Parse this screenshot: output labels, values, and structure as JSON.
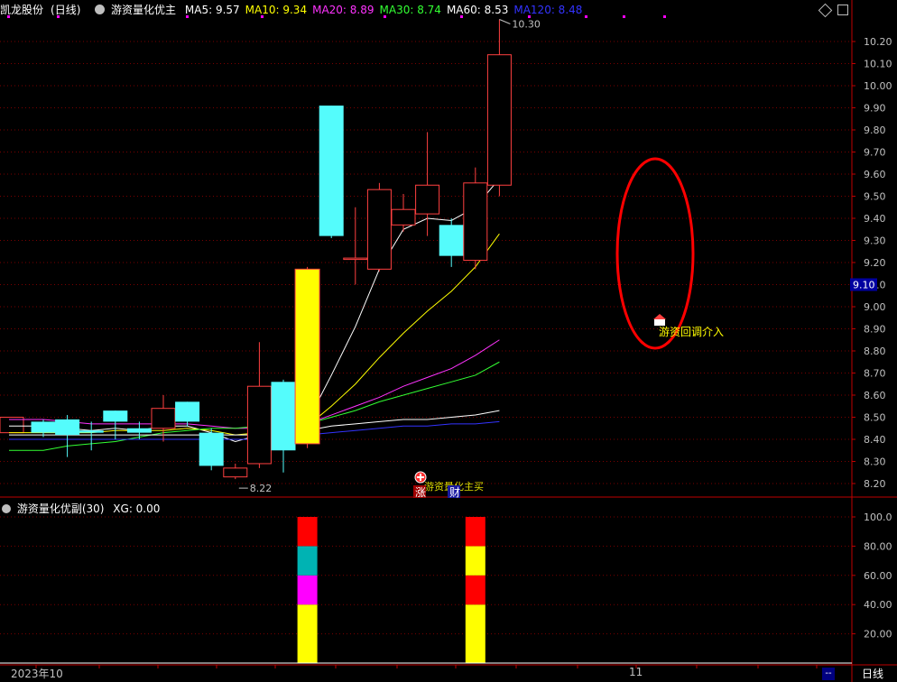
{
  "header": {
    "stock_name": "凯龙股份",
    "period_label": "(日线)",
    "indicator_name": "游资量化优主",
    "ma_items": [
      {
        "label": "MA5:",
        "value": "9.57",
        "color": "#ffffff"
      },
      {
        "label": "MA10:",
        "value": "9.34",
        "color": "#ffff00"
      },
      {
        "label": "MA20:",
        "value": "8.89",
        "color": "#ff33ff"
      },
      {
        "label": "MA30:",
        "value": "8.74",
        "color": "#33ff33"
      },
      {
        "label": "MA60:",
        "value": "8.53",
        "color": "#ffffff"
      },
      {
        "label": "MA120:",
        "value": "8.48",
        "color": "#3333ff"
      }
    ]
  },
  "sub_header": {
    "indicator_name": "游资量化优副(30)",
    "xg_label": "XG: 0.00"
  },
  "annotations": {
    "high_label": "10.30",
    "low_label": "8.22",
    "signal_text": "游资回调介入",
    "buy_text": "游资量化主买",
    "limit_up_tag": "涨",
    "finance_tag": "财",
    "current_price_tag": "9.10"
  },
  "bottom": {
    "date_left": "2023年10",
    "date_month": "11",
    "period_button": "日线",
    "minus_label": "--"
  },
  "colors": {
    "up": "#ff4040",
    "down": "#54fcfc",
    "limit_up": "#ffff00",
    "grid": "#7a0000",
    "axis": "#c00000",
    "circle": "#ff0000"
  },
  "chart_data": [
    {
      "type": "candlestick",
      "ylim": [
        8.15,
        10.35
      ],
      "y_ticks": [
        "10.20",
        "10.10",
        "10.00",
        "9.90",
        "9.80",
        "9.70",
        "9.60",
        "9.50",
        "9.40",
        "9.30",
        "9.20",
        "9.10",
        "9.00",
        "8.90",
        "8.80",
        "8.70",
        "8.60",
        "8.50",
        "8.40",
        "8.30",
        "8.20"
      ],
      "candles": [
        {
          "o": 8.48,
          "c": 8.43,
          "h": 8.49,
          "l": 8.41
        },
        {
          "o": 8.49,
          "c": 8.42,
          "h": 8.51,
          "l": 8.32
        },
        {
          "o": 8.44,
          "c": 8.43,
          "h": 8.48,
          "l": 8.35
        },
        {
          "o": 8.53,
          "c": 8.48,
          "h": 8.53,
          "l": 8.4
        },
        {
          "o": 8.45,
          "c": 8.43,
          "h": 8.48,
          "l": 8.4
        },
        {
          "o": 8.45,
          "c": 8.54,
          "h": 8.6,
          "l": 8.39
        },
        {
          "o": 8.57,
          "c": 8.48,
          "h": 8.57,
          "l": 8.46
        },
        {
          "o": 8.43,
          "c": 8.28,
          "h": 8.45,
          "l": 8.26
        },
        {
          "o": 8.23,
          "c": 8.27,
          "h": 8.29,
          "l": 8.22
        },
        {
          "o": 8.29,
          "c": 8.64,
          "h": 8.84,
          "l": 8.27
        },
        {
          "o": 8.66,
          "c": 8.35,
          "h": 8.67,
          "l": 8.25
        },
        {
          "o": 8.38,
          "c": 9.17,
          "h": 9.18,
          "l": 8.36,
          "limit": true
        },
        {
          "o": 9.91,
          "c": 9.32,
          "h": 9.91,
          "l": 9.31
        },
        {
          "o": 9.22,
          "c": 9.22,
          "h": 9.45,
          "l": 9.1
        },
        {
          "o": 9.17,
          "c": 9.53,
          "h": 9.56,
          "l": 9.16
        },
        {
          "o": 9.37,
          "c": 9.44,
          "h": 9.51,
          "l": 9.34
        },
        {
          "o": 9.42,
          "c": 9.55,
          "h": 9.79,
          "l": 9.32
        },
        {
          "o": 9.37,
          "c": 9.23,
          "h": 9.4,
          "l": 9.18
        },
        {
          "o": 9.21,
          "c": 9.56,
          "h": 9.63,
          "l": 9.17
        },
        {
          "o": 9.55,
          "c": 10.14,
          "h": 10.3,
          "l": 9.5
        }
      ],
      "ma_lines": [
        {
          "name": "MA5",
          "color": "#ffffff",
          "values": [
            8.46,
            8.45,
            8.44,
            8.45,
            8.44,
            8.46,
            8.46,
            8.43,
            8.39,
            8.42,
            8.39,
            8.48,
            8.69,
            8.91,
            9.17,
            9.35,
            9.4,
            9.39,
            9.45,
            9.58
          ]
        },
        {
          "name": "MA10",
          "color": "#ffff00",
          "values": [
            8.43,
            8.43,
            8.43,
            8.44,
            8.44,
            8.44,
            8.45,
            8.44,
            8.42,
            8.43,
            8.42,
            8.46,
            8.55,
            8.65,
            8.77,
            8.88,
            8.98,
            9.07,
            9.18,
            9.33
          ]
        },
        {
          "name": "MA20",
          "color": "#ff33ff",
          "values": [
            8.49,
            8.48,
            8.47,
            8.47,
            8.47,
            8.47,
            8.47,
            8.46,
            8.45,
            8.45,
            8.44,
            8.47,
            8.51,
            8.55,
            8.59,
            8.64,
            8.68,
            8.72,
            8.78,
            8.85
          ]
        },
        {
          "name": "MA30",
          "color": "#33ff33",
          "values": [
            8.35,
            8.37,
            8.38,
            8.39,
            8.41,
            8.43,
            8.44,
            8.45,
            8.45,
            8.46,
            8.46,
            8.47,
            8.5,
            8.53,
            8.57,
            8.6,
            8.63,
            8.66,
            8.69,
            8.75
          ]
        },
        {
          "name": "MA60",
          "color": "#ffffff",
          "values": [
            8.42,
            8.42,
            8.42,
            8.42,
            8.42,
            8.42,
            8.42,
            8.42,
            8.42,
            8.42,
            8.42,
            8.44,
            8.46,
            8.47,
            8.48,
            8.49,
            8.49,
            8.5,
            8.51,
            8.53
          ]
        },
        {
          "name": "MA120",
          "color": "#3333ff",
          "values": [
            8.4,
            8.4,
            8.4,
            8.4,
            8.4,
            8.4,
            8.4,
            8.4,
            8.4,
            8.4,
            8.4,
            8.42,
            8.43,
            8.44,
            8.45,
            8.46,
            8.46,
            8.47,
            8.47,
            8.48
          ]
        }
      ]
    },
    {
      "type": "bar",
      "ylim": [
        0,
        105
      ],
      "y_ticks": [
        "100.0",
        "80.00",
        "60.00",
        "40.00",
        "20.00"
      ],
      "stacks": [
        {
          "index": 11,
          "segments": [
            {
              "from": 0,
              "to": 40,
              "color": "#ffff00"
            },
            {
              "from": 40,
              "to": 60,
              "color": "#ff00ff"
            },
            {
              "from": 60,
              "to": 80,
              "color": "#00b3b3"
            },
            {
              "from": 80,
              "to": 100,
              "color": "#ff0000"
            }
          ]
        },
        {
          "index": 18,
          "segments": [
            {
              "from": 0,
              "to": 40,
              "color": "#ffff00"
            },
            {
              "from": 40,
              "to": 60,
              "color": "#ff0000"
            },
            {
              "from": 60,
              "to": 80,
              "color": "#ffff00"
            },
            {
              "from": 80,
              "to": 100,
              "color": "#ff0000"
            }
          ]
        }
      ]
    }
  ]
}
